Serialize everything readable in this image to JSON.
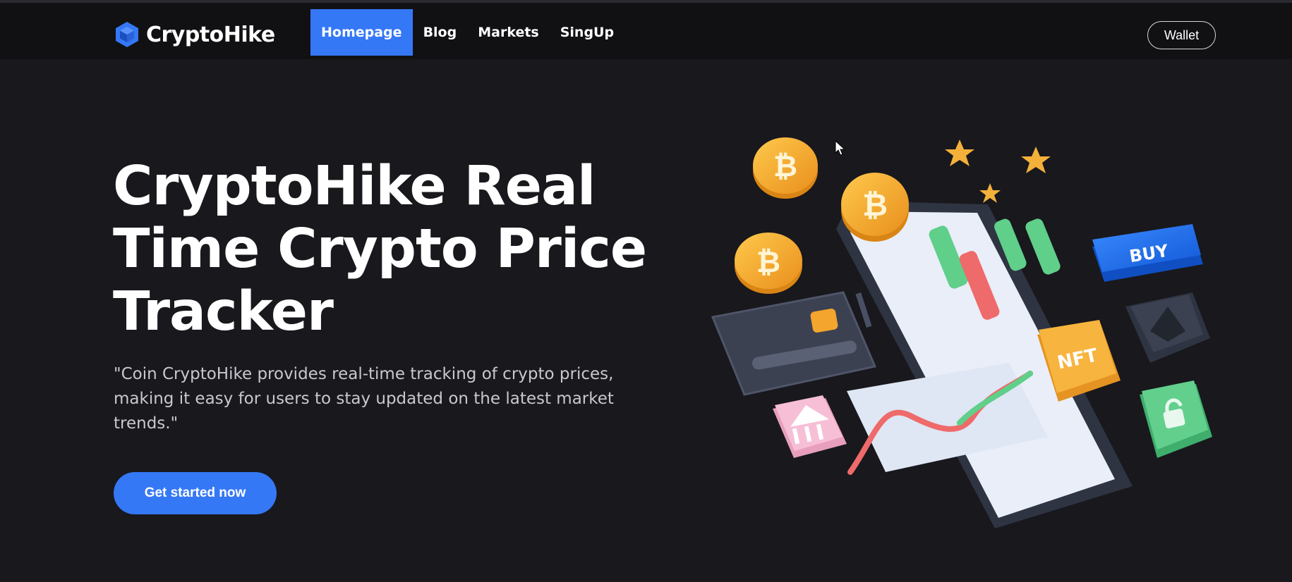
{
  "brand": {
    "name": "CryptoHike",
    "logo_icon": "cube-icon",
    "accent": "#3578f6"
  },
  "nav": {
    "items": [
      {
        "label": "Homepage",
        "active": true
      },
      {
        "label": "Blog",
        "active": false
      },
      {
        "label": "Markets",
        "active": false
      },
      {
        "label": "SingUp",
        "active": false
      }
    ],
    "wallet_label": "Wallet"
  },
  "hero": {
    "title": "CryptoHike Real Time Crypto Price Tracker",
    "description": "\"Coin CryptoHike provides real-time tracking of crypto prices, making it easy for users to stay updated on the latest market trends.\"",
    "cta_label": "Get started now"
  },
  "illustration": {
    "buy_label": "BUY",
    "nft_label": "NFT",
    "coin_symbol": "₿",
    "colors": {
      "coin": "#f3a52e",
      "buy": "#1f6fe8",
      "green": "#5fcf8a",
      "red": "#ef6a6a",
      "dark": "#3b4150",
      "phone_screen": "#e9eef8"
    }
  },
  "background": "#18181d"
}
